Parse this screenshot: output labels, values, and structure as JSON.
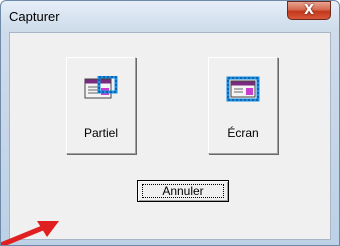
{
  "window": {
    "title": "Capturer",
    "close_symbol": "X"
  },
  "buttons": {
    "partial": {
      "label": "Partiel",
      "icon": "partial-capture-icon"
    },
    "screen": {
      "label": "Écran",
      "icon": "screen-capture-icon"
    },
    "cancel": {
      "label": "Annuler"
    }
  },
  "colors": {
    "icon_selection": "#1a8fe8",
    "icon_accent": "#c83cd0",
    "close_red": "#c2381c",
    "arrow_red": "#e02020"
  }
}
